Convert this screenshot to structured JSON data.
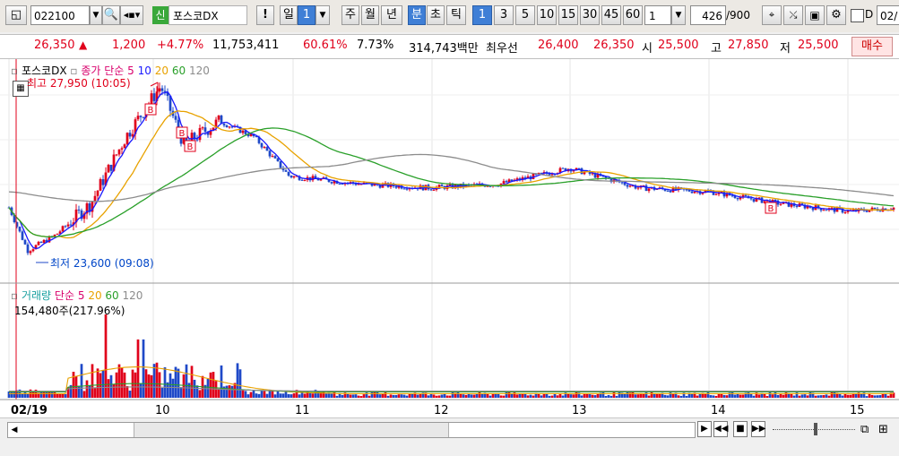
{
  "toolbar": {
    "code": "022100",
    "badge": "신",
    "name": "포스코DX",
    "exclaim": "!",
    "period_day": "일",
    "period_day_num": "1",
    "period_week": "주",
    "period_month": "월",
    "period_year": "년",
    "unit_min": "분",
    "unit_sec": "초",
    "unit_tick": "틱",
    "intervals": [
      "1",
      "3",
      "5",
      "10",
      "15",
      "30",
      "45",
      "60"
    ],
    "interval_selected": "1",
    "multiplier": "1",
    "count": "426",
    "count_max": "/900",
    "check_label": "D",
    "date_field": "02/"
  },
  "info": {
    "price": "26,350",
    "up_arrow": "▲",
    "change": "1,200",
    "change_pct": "+4.77%",
    "volume": "11,753,411",
    "vol_ratio": "60.61%",
    "turnover": "7.73%",
    "amount": "314,743백만",
    "best_label": "최우선",
    "best_ask": "26,400",
    "best_bid": "26,350",
    "open_label": "시",
    "open": "25,500",
    "high_label": "고",
    "high": "27,850",
    "low_label": "저",
    "low": "25,500",
    "buy_button": "매수"
  },
  "price_panel": {
    "legend_name": "포스코DX",
    "legend_type": "종가 단순",
    "ma": [
      "5",
      "10",
      "20",
      "60",
      "120"
    ],
    "high_note": "최고 27,950 (10:05)",
    "low_note": "최저 23,600 (09:08)",
    "marker": "B"
  },
  "volume_panel": {
    "legend_name": "거래량",
    "legend_type": "단순",
    "ma": [
      "5",
      "20",
      "60",
      "120"
    ],
    "value_note": "154,480주(217.96%)"
  },
  "xaxis": {
    "ticks": [
      "02/19",
      "10",
      "11",
      "12",
      "13",
      "14",
      "15"
    ]
  },
  "colors": {
    "up": "#e0001b",
    "down": "#1f49c8",
    "ma5": "#1a1aff",
    "ma20": "#e8a200",
    "ma60": "#2aa02a",
    "ma120": "#8c8c8c"
  },
  "chart_data": {
    "type": "candlestick",
    "x_label_ticks": [
      "02/19",
      "10",
      "11",
      "12",
      "13",
      "14",
      "15"
    ],
    "price_points": [
      {
        "time": "09:00",
        "close": 24700
      },
      {
        "time": "09:08",
        "close": 23600
      },
      {
        "time": "09:20",
        "close": 24000
      },
      {
        "time": "09:35",
        "close": 24800
      },
      {
        "time": "09:50",
        "close": 26500
      },
      {
        "time": "10:05",
        "close": 27800
      },
      {
        "time": "10:15",
        "close": 26300
      },
      {
        "time": "10:30",
        "close": 26900
      },
      {
        "time": "10:45",
        "close": 26500
      },
      {
        "time": "11:00",
        "close": 25500
      },
      {
        "time": "11:30",
        "close": 25300
      },
      {
        "time": "12:00",
        "close": 25200
      },
      {
        "time": "12:30",
        "close": 25300
      },
      {
        "time": "13:00",
        "close": 25700
      },
      {
        "time": "13:30",
        "close": 25200
      },
      {
        "time": "14:00",
        "close": 25100
      },
      {
        "time": "14:30",
        "close": 24800
      },
      {
        "time": "15:00",
        "close": 24600
      },
      {
        "time": "15:20",
        "close": 24700
      }
    ],
    "high": 27950,
    "low": 23600
  }
}
